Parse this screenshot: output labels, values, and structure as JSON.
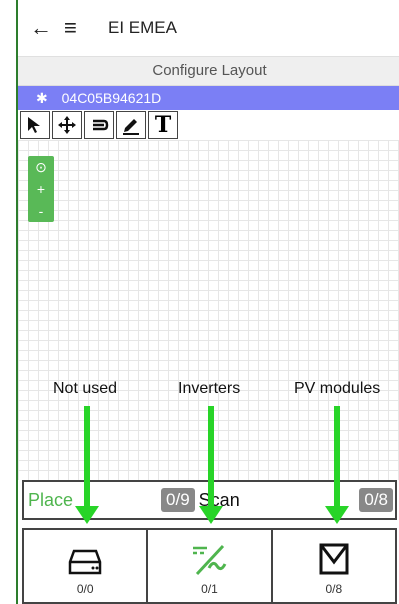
{
  "header": {
    "back_icon": "arrow-left-icon",
    "menu_icon": "hamburger-menu-icon",
    "title": "EI EMEA"
  },
  "configure_title": "Configure Layout",
  "device": {
    "icon": "bluetooth-icon",
    "id": "04C05B94621D"
  },
  "toolbar": {
    "tools": [
      "select-arrow",
      "move",
      "undo",
      "pencil",
      "text"
    ],
    "text_label": "T"
  },
  "zoom": {
    "locate": "⊙",
    "in": "+",
    "out": "-"
  },
  "annotations": {
    "not_used": "Not used",
    "inverters": "Inverters",
    "pv_modules": "PV modules"
  },
  "tabs": {
    "place": "Place",
    "place_badge": "0/9",
    "scan": "Scan",
    "scan_badge": "0/8"
  },
  "bottom": {
    "items": [
      {
        "icon": "device-box-icon",
        "count": "0/0"
      },
      {
        "icon": "inverter-icon",
        "count": "0/1"
      },
      {
        "icon": "pv-module-icon",
        "count": "0/8"
      }
    ]
  },
  "colors": {
    "device_bar": "#7b7ff5",
    "accent_green": "#59b957",
    "arrow_green": "#28d428"
  }
}
